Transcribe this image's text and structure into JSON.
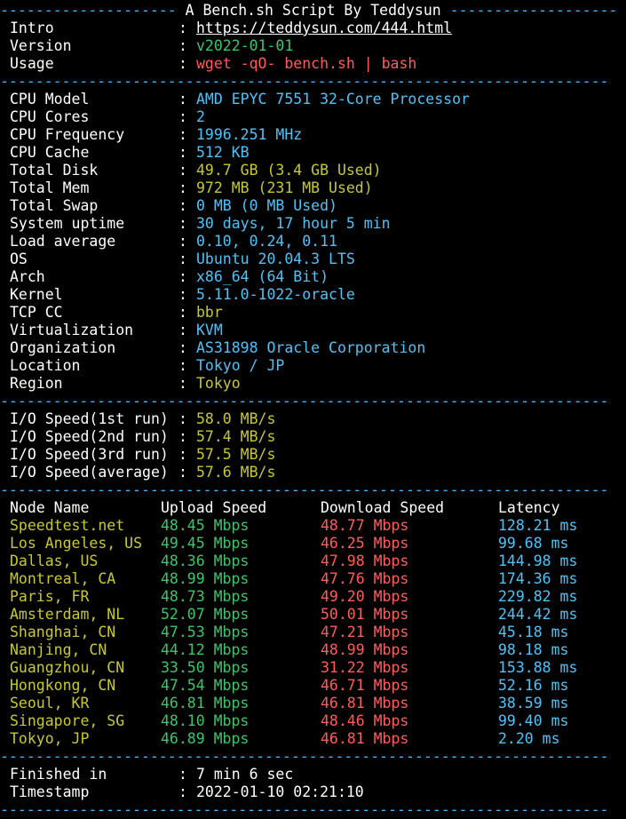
{
  "header": {
    "dashes_left": "--------------------",
    "title": " A Bench.sh Script By Teddysun ",
    "dashes_right": "-------------------"
  },
  "separator": "---------------------------------------------------------------------",
  "colon": ":",
  "info": {
    "intro": {
      "label": "Intro",
      "value": "https://teddysun.com/444.html"
    },
    "version": {
      "label": "Version",
      "value": "v2022-01-01"
    },
    "usage": {
      "label": "Usage",
      "value": "wget -qO- bench.sh | bash"
    }
  },
  "system": [
    {
      "label": "CPU Model",
      "value": "AMD EPYC 7551 32-Core Processor",
      "color": "cyan"
    },
    {
      "label": "CPU Cores",
      "value": "2",
      "color": "cyan"
    },
    {
      "label": "CPU Frequency",
      "value": "1996.251 MHz",
      "color": "cyan"
    },
    {
      "label": "CPU Cache",
      "value": "512 KB",
      "color": "cyan"
    },
    {
      "label": "Total Disk",
      "value": "49.7 GB (3.4 GB Used)",
      "color": "yellow"
    },
    {
      "label": "Total Mem",
      "value": "972 MB (231 MB Used)",
      "color": "yellow"
    },
    {
      "label": "Total Swap",
      "value": "0 MB (0 MB Used)",
      "color": "cyan"
    },
    {
      "label": "System uptime",
      "value": "30 days, 17 hour 5 min",
      "color": "cyan"
    },
    {
      "label": "Load average",
      "value": "0.10, 0.24, 0.11",
      "color": "cyan"
    },
    {
      "label": "OS",
      "value": "Ubuntu 20.04.3 LTS",
      "color": "cyan"
    },
    {
      "label": "Arch",
      "value": "x86_64 (64 Bit)",
      "color": "cyan"
    },
    {
      "label": "Kernel",
      "value": "5.11.0-1022-oracle",
      "color": "cyan"
    },
    {
      "label": "TCP CC",
      "value": "bbr",
      "color": "yellow"
    },
    {
      "label": "Virtualization",
      "value": "KVM",
      "color": "cyan"
    },
    {
      "label": "Organization",
      "value": "AS31898 Oracle Corporation",
      "color": "cyan"
    },
    {
      "label": "Location",
      "value": "Tokyo / JP",
      "color": "cyan"
    },
    {
      "label": "Region",
      "value": "Tokyo",
      "color": "yellow"
    }
  ],
  "io": [
    {
      "label": "I/O Speed(1st run)",
      "value": "58.0 MB/s"
    },
    {
      "label": "I/O Speed(2nd run)",
      "value": "57.4 MB/s"
    },
    {
      "label": "I/O Speed(3rd run)",
      "value": "57.5 MB/s"
    },
    {
      "label": "I/O Speed(average)",
      "value": "57.6 MB/s"
    }
  ],
  "speedtest": {
    "headers": {
      "node": "Node Name",
      "upload": "Upload Speed",
      "download": "Download Speed",
      "latency": "Latency"
    },
    "rows": [
      {
        "node": "Speedtest.net",
        "upload": "48.45 Mbps",
        "download": "48.77 Mbps",
        "latency": "128.21 ms"
      },
      {
        "node": "Los Angeles, US",
        "upload": "49.45 Mbps",
        "download": "46.25 Mbps",
        "latency": "99.68 ms"
      },
      {
        "node": "Dallas, US",
        "upload": "48.36 Mbps",
        "download": "47.98 Mbps",
        "latency": "144.98 ms"
      },
      {
        "node": "Montreal, CA",
        "upload": "48.99 Mbps",
        "download": "47.76 Mbps",
        "latency": "174.36 ms"
      },
      {
        "node": "Paris, FR",
        "upload": "48.73 Mbps",
        "download": "49.20 Mbps",
        "latency": "229.82 ms"
      },
      {
        "node": "Amsterdam, NL",
        "upload": "52.07 Mbps",
        "download": "50.01 Mbps",
        "latency": "244.42 ms"
      },
      {
        "node": "Shanghai, CN",
        "upload": "47.53 Mbps",
        "download": "47.21 Mbps",
        "latency": "45.18 ms"
      },
      {
        "node": "Nanjing, CN",
        "upload": "44.12 Mbps",
        "download": "48.99 Mbps",
        "latency": "98.18 ms"
      },
      {
        "node": "Guangzhou, CN",
        "upload": "33.50 Mbps",
        "download": "31.22 Mbps",
        "latency": "153.88 ms"
      },
      {
        "node": "Hongkong, CN",
        "upload": "47.54 Mbps",
        "download": "46.71 Mbps",
        "latency": "52.16 ms"
      },
      {
        "node": "Seoul, KR",
        "upload": "46.81 Mbps",
        "download": "46.81 Mbps",
        "latency": "38.59 ms"
      },
      {
        "node": "Singapore, SG",
        "upload": "48.10 Mbps",
        "download": "48.46 Mbps",
        "latency": "99.40 ms"
      },
      {
        "node": "Tokyo, JP",
        "upload": "46.89 Mbps",
        "download": "46.81 Mbps",
        "latency": "2.20 ms"
      }
    ]
  },
  "footer": {
    "finished": {
      "label": "Finished in",
      "value": "7 min 6 sec"
    },
    "timestamp": {
      "label": "Timestamp",
      "value": "2022-01-10 02:21:10"
    }
  },
  "colors": {
    "background": "#000000",
    "separator": "#3fb6ff",
    "cyan": "#4fc3f7",
    "yellow": "#c8c832",
    "green": "#3ec46d",
    "red": "#ff5c5c"
  }
}
